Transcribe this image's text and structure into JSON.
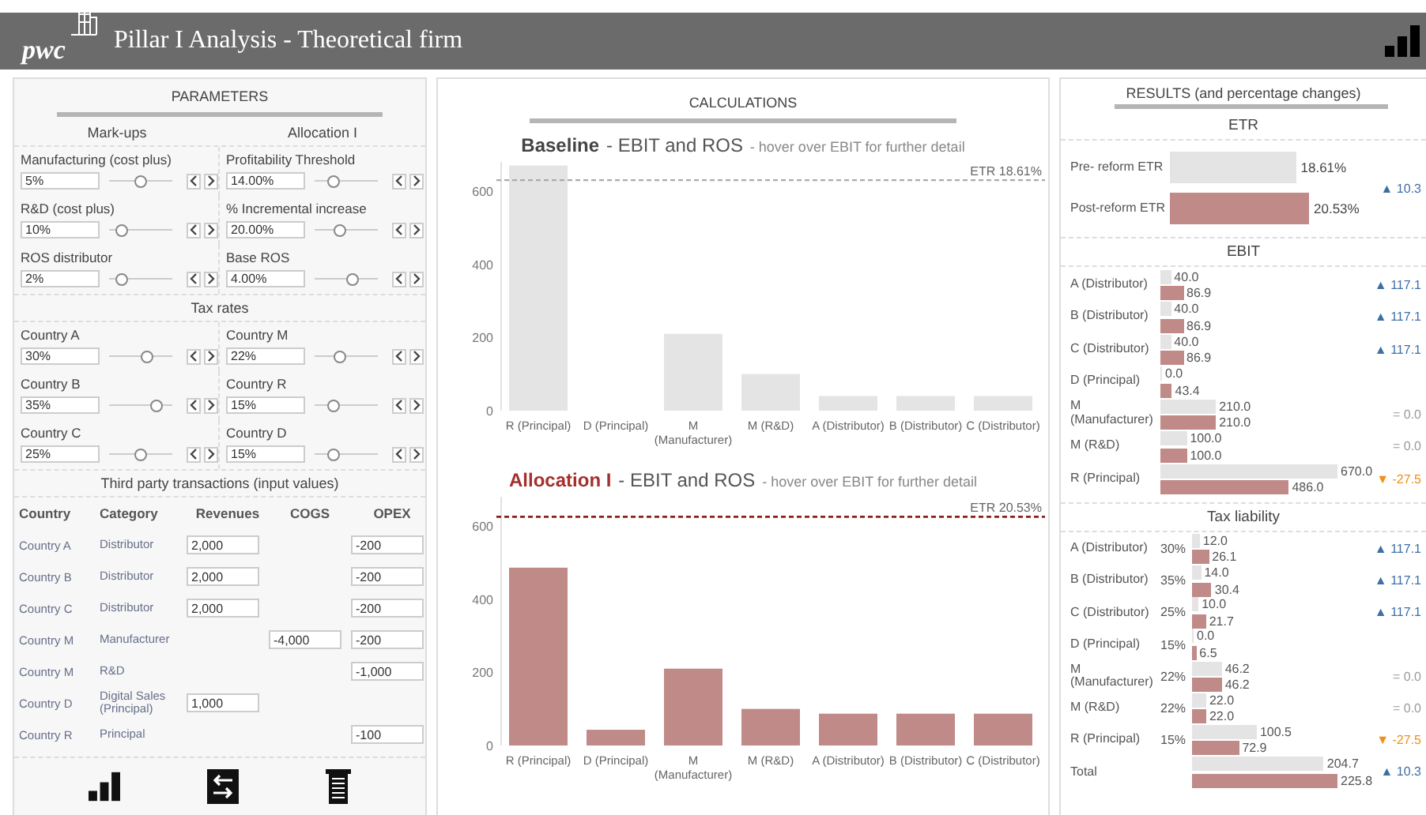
{
  "header": {
    "logo": "pwc",
    "title": "Pillar I Analysis - Theoretical firm"
  },
  "parameters": {
    "title": "PARAMETERS",
    "column_headings": [
      "Mark-ups",
      "Allocation I"
    ],
    "markup_items": [
      {
        "label": "Manufacturing (cost plus)",
        "value": "5%",
        "level": 0.5
      },
      {
        "label": "Profitability Threshold",
        "value": "14.00%",
        "level": 0.3
      },
      {
        "label": "R&D (cost plus)",
        "value": "10%",
        "level": 0.2
      },
      {
        "label": "% Incremental increase",
        "value": "20.00%",
        "level": 0.4
      },
      {
        "label": "ROS distributor",
        "value": "2%",
        "level": 0.2
      },
      {
        "label": "Base ROS",
        "value": "4.00%",
        "level": 0.6
      }
    ],
    "tax_heading": "Tax rates",
    "tax_items": [
      {
        "label": "Country A",
        "value": "30%",
        "level": 0.6
      },
      {
        "label": "Country M",
        "value": "22%",
        "level": 0.4
      },
      {
        "label": "Country B",
        "value": "35%",
        "level": 0.75
      },
      {
        "label": "Country R",
        "value": "15%",
        "level": 0.3
      },
      {
        "label": "Country C",
        "value": "25%",
        "level": 0.5
      },
      {
        "label": "Country D",
        "value": "15%",
        "level": 0.3
      }
    ]
  },
  "transactions": {
    "heading": "Third party transactions (input values)",
    "columns": [
      "Country",
      "Category",
      "Revenues",
      "COGS",
      "OPEX"
    ],
    "rows": [
      {
        "country": "Country A",
        "category": "Distributor",
        "revenues": "2,000",
        "opex": "-200"
      },
      {
        "country": "Country B",
        "category": "Distributor",
        "revenues": "2,000",
        "opex": "-200"
      },
      {
        "country": "Country C",
        "category": "Distributor",
        "revenues": "2,000",
        "opex": "-200"
      },
      {
        "country": "Country M",
        "category": "Manufacturer",
        "cogs": "-4,000",
        "opex": "-200"
      },
      {
        "country": "Country M",
        "category": "R&D",
        "opex": "-1,000"
      },
      {
        "country": "Country D",
        "category": "Digital Sales (Principal)",
        "revenues": "1,000"
      },
      {
        "country": "Country R",
        "category": "Principal",
        "opex": "-100"
      }
    ]
  },
  "calculations": {
    "title": "CALCULATIONS",
    "charts": [
      {
        "kind": "baseline",
        "heading": "Baseline",
        "subtitle": "- EBIT and ROS",
        "hint": "- hover over EBIT for further detail",
        "chart_data": {
          "type": "bar",
          "categories": [
            "R (Principal)",
            "D (Principal)",
            "M (Manufacturer)",
            "M (R&D)",
            "A (Distributor)",
            "B (Distributor)",
            "C (Distributor)"
          ],
          "series": [
            {
              "color": "#e4e4e4",
              "values": [
                670,
                0,
                210,
                100,
                40,
                40,
                40
              ]
            }
          ],
          "yticks": [
            0,
            200,
            400,
            600
          ],
          "ylim": [
            0,
            680
          ],
          "ref_lines": [
            {
              "axis": "y",
              "value": 630,
              "label": "ETR 18.61%"
            }
          ]
        }
      },
      {
        "kind": "allocation",
        "heading": "Allocation I",
        "subtitle": "- EBIT and ROS",
        "hint": "- hover over EBIT for further detail",
        "chart_data": {
          "type": "bar",
          "categories": [
            "R (Principal)",
            "D (Principal)",
            "M (Manufacturer)",
            "M (R&D)",
            "A (Distributor)",
            "B (Distributor)",
            "C (Distributor)"
          ],
          "series": [
            {
              "color": "#c08a88",
              "values": [
                486,
                43,
                210,
                100,
                87,
                87,
                87
              ]
            }
          ],
          "yticks": [
            0,
            200,
            400,
            600
          ],
          "ylim": [
            0,
            680
          ],
          "ref_lines": [
            {
              "axis": "y",
              "value": 625,
              "label": "ETR 20.53%"
            }
          ]
        }
      }
    ]
  },
  "results": {
    "title": "RESULTS (and percentage changes)",
    "etr": {
      "heading": "ETR",
      "rows": [
        {
          "label": "Pre- reform ETR",
          "value": "18.61%",
          "kind": "baseline"
        },
        {
          "label": "Post-reform ETR",
          "value": "20.53%",
          "kind": "allocation"
        }
      ],
      "change": {
        "text": "▲ 10.3",
        "color": "#3d6fa6"
      }
    },
    "ebit": {
      "heading": "EBIT",
      "rows": [
        {
          "label": "A (Distributor)",
          "baseline": "40.0",
          "allocation": "86.9",
          "change": {
            "text": "▲ 117.1",
            "color": "#3d6fa6"
          }
        },
        {
          "label": "B (Distributor)",
          "baseline": "40.0",
          "allocation": "86.9",
          "change": {
            "text": "▲ 117.1",
            "color": "#3d6fa6"
          }
        },
        {
          "label": "C (Distributor)",
          "baseline": "40.0",
          "allocation": "86.9",
          "change": {
            "text": "▲ 117.1",
            "color": "#3d6fa6"
          }
        },
        {
          "label": "D (Principal)",
          "baseline": "0.0",
          "allocation": "43.4"
        },
        {
          "label": "M (Manufacturer)",
          "baseline": "210.0",
          "allocation": "210.0",
          "change": {
            "text": "= 0.0",
            "color": "#9a9a9a"
          }
        },
        {
          "label": "M (R&D)",
          "baseline": "100.0",
          "allocation": "100.0",
          "change": {
            "text": "= 0.0",
            "color": "#9a9a9a"
          }
        },
        {
          "label": "R (Principal)",
          "baseline": "670.0",
          "allocation": "486.0",
          "change": {
            "text": "▼ -27.5",
            "color": "#f0901c"
          }
        }
      ]
    },
    "tax": {
      "heading": "Tax liability",
      "rows": [
        {
          "label": "A (Distributor)",
          "rate": "30%",
          "baseline": "12.0",
          "allocation": "26.1",
          "change": {
            "text": "▲ 117.1",
            "color": "#3d6fa6"
          }
        },
        {
          "label": "B (Distributor)",
          "rate": "35%",
          "baseline": "14.0",
          "allocation": "30.4",
          "change": {
            "text": "▲ 117.1",
            "color": "#3d6fa6"
          }
        },
        {
          "label": "C (Distributor)",
          "rate": "25%",
          "baseline": "10.0",
          "allocation": "21.7",
          "change": {
            "text": "▲ 117.1",
            "color": "#3d6fa6"
          }
        },
        {
          "label": "D (Principal)",
          "rate": "15%",
          "baseline": "0.0",
          "allocation": "6.5"
        },
        {
          "label": "M (Manufacturer)",
          "rate": "22%",
          "baseline": "46.2",
          "allocation": "46.2",
          "change": {
            "text": "= 0.0",
            "color": "#9a9a9a"
          }
        },
        {
          "label": "M (R&D)",
          "rate": "22%",
          "baseline": "22.0",
          "allocation": "22.0",
          "change": {
            "text": "= 0.0",
            "color": "#9a9a9a"
          }
        },
        {
          "label": "R (Principal)",
          "rate": "15%",
          "baseline": "100.5",
          "allocation": "72.9",
          "change": {
            "text": "▼ -27.5",
            "color": "#f0901c"
          }
        },
        {
          "label": "Total",
          "baseline": "204.7",
          "allocation": "225.8",
          "change": {
            "text": "▲ 10.3",
            "color": "#3d6fa6"
          }
        }
      ]
    }
  }
}
